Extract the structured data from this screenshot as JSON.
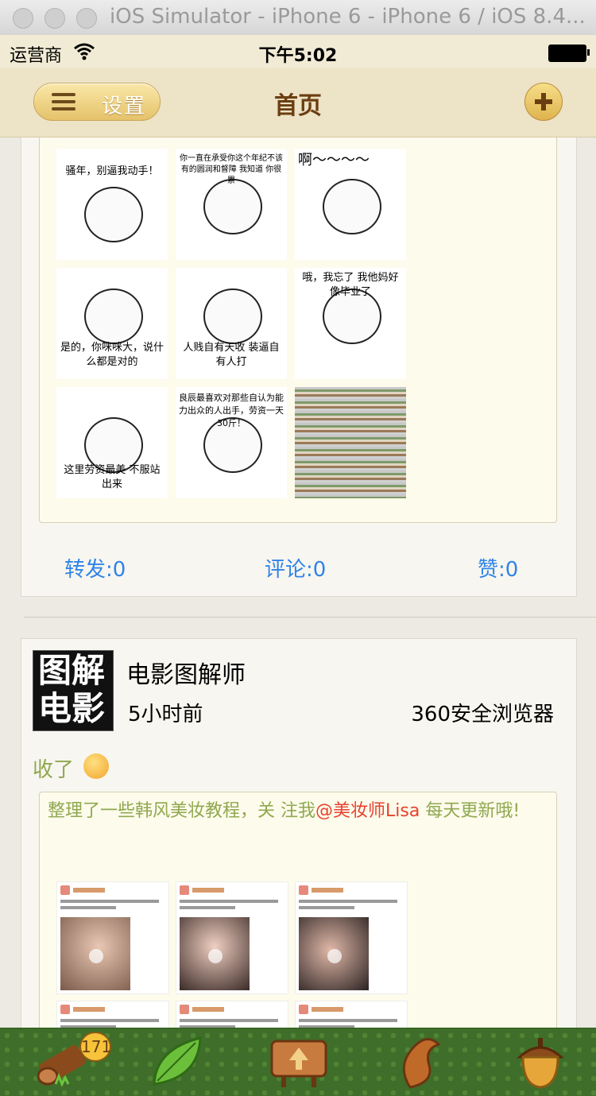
{
  "window": {
    "title": "iOS Simulator - iPhone 6 - iPhone 6 / iOS 8.4..."
  },
  "status_bar": {
    "carrier": "运营商",
    "time": "下午5:02"
  },
  "nav": {
    "settings_label": "设置",
    "title": "首页"
  },
  "post1": {
    "memes": [
      {
        "text": "骚年，别逼我动手！"
      },
      {
        "text": "你一直在承受你这个年纪不该有的圆润和督障 我知道 你很累"
      },
      {
        "text": "啊～～～～"
      },
      {
        "text": ""
      },
      {
        "text": ""
      },
      {
        "text": "哦，我忘了 我他妈好像毕业了"
      },
      {
        "text": "是的，你咪咪大，说什么都是对的"
      },
      {
        "text": "人贱自有天收 装逼自有人打"
      },
      {
        "text": ""
      },
      {
        "text": "这里劳资最美 不服站出来"
      },
      {
        "text": "良辰最喜欢对那些自认为能力出众的人出手，劳资一天30斤！"
      },
      {
        "text": ""
      }
    ],
    "stats": {
      "forward": "转发:0",
      "comment": "评论:0",
      "like": "赞:0"
    }
  },
  "post2": {
    "author": "电影图解师",
    "avatar_text": [
      "图解",
      "电影"
    ],
    "time": "5小时前",
    "source": "360安全浏览器",
    "text": "收了",
    "quote": {
      "before": "整理了一些韩风美妆教程，关 注我",
      "mention": "@美妆师Lisa",
      "after": " 每天更新哦!"
    }
  },
  "tabbar": {
    "badge": "171",
    "items": [
      "wood-log-icon",
      "leaf-icon",
      "sign-board-icon",
      "squirrel-tail-icon",
      "acorn-icon"
    ]
  },
  "colors": {
    "nav_bg": "#ede3c6",
    "link_blue": "#2f84e8",
    "quote_green": "#8fa84f",
    "mention_red": "#e8412f",
    "tab_green": "#3f6e2a"
  }
}
